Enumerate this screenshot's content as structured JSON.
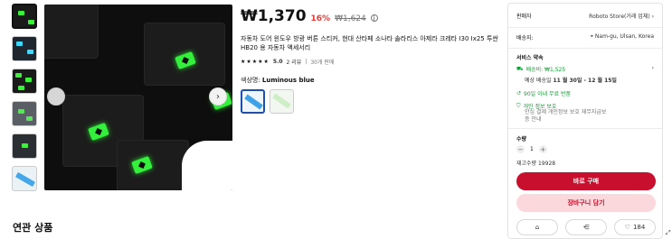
{
  "product": {
    "price": "₩1,370",
    "discount": "16%",
    "original_price": "₩1,624",
    "title": "자동차 도어 윈도우 방광 버튼 스티커, 현대 산타페 소나타 솔라리스 아제라 크레타 I30 Ix25 투싼 HB20 용 자동차 액세서리",
    "rating_stars": "★★★★★",
    "rating_score": "5.0",
    "rating_reviews": "2 리뷰",
    "rating_sold": "30개 판매",
    "color_label": "색상명:",
    "color_value": "Luminous blue"
  },
  "panel": {
    "seller_label": "판매자",
    "seller_value": "Roboto Store(거래 업체)",
    "shipping_label": "배송지:",
    "shipping_value": "Nam-gu, Ulsan, Korea",
    "service_title": "서비스 약속",
    "shipping_fee": "배송비: ₩1,525",
    "eta_prefix": "예상 배송일",
    "eta_value": "11 월 30일 - 12 월 15일",
    "returns": "90일 이내 무료 반품",
    "privacy": "개인 정보 보호",
    "privacy_desc": "안심 결제 개인정보 보호 재무지급보증 안내",
    "quantity_label": "수량",
    "quantity_value": "1",
    "stock_label": "재고수량 19928",
    "buy_now": "바로 구매",
    "add_to_cart": "장바구니 담기",
    "wishlist_count": "184"
  },
  "related_title": "연관 상품",
  "colors": {
    "accent_red": "#c8102e",
    "green": "#1b9c3a",
    "discount_red": "#e53935"
  },
  "icons": {
    "prev": "chevron-left-icon",
    "next": "chevron-right-icon",
    "location": "location-pin-icon",
    "store": "store-icon",
    "share": "share-icon",
    "heart": "heart-icon"
  }
}
